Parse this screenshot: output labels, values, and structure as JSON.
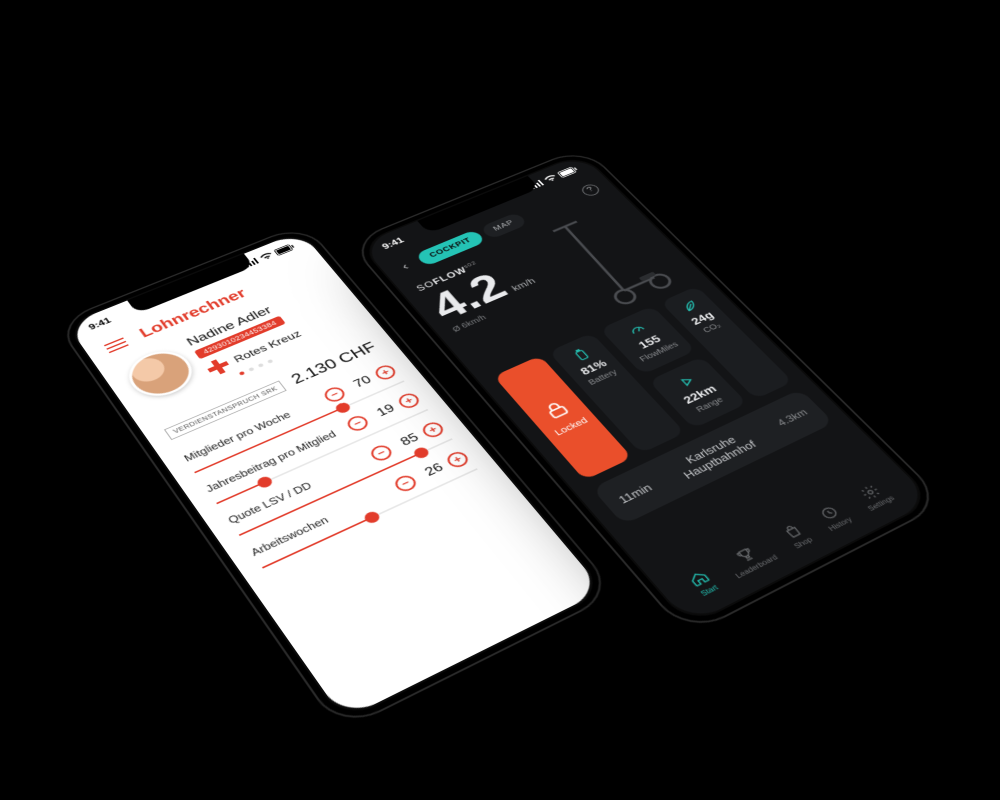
{
  "status": {
    "time": "9:41"
  },
  "left": {
    "title": "Lohnrechner",
    "user_name": "Nadine Adler",
    "user_id": "4293010234453384",
    "org": "Rotes Kreuz",
    "earn_label": "VERDIENSTANSPRUCH SRK",
    "earn_value": "2.130 CHF",
    "sliders": [
      {
        "label": "Mitglieder pro Woche",
        "value": "70",
        "pct": 70
      },
      {
        "label": "Jahresbeitrag pro Mitglied",
        "value": "19",
        "pct": 22
      },
      {
        "label": "Quote LSV / DD",
        "value": "85",
        "pct": 85
      },
      {
        "label": "Arbeitswochen",
        "value": "26",
        "pct": 50
      }
    ]
  },
  "right": {
    "tabs": {
      "cockpit": "COCKPIT",
      "map": "MAP"
    },
    "brand": "SOFLOW",
    "brand_model": "s02",
    "speed": "4.2",
    "speed_unit": "km/h",
    "avg": "Ø 6km/h",
    "tiles": {
      "locked": "Locked",
      "battery": {
        "value": "81%",
        "label": "Battery"
      },
      "flowmiles": {
        "value": "155",
        "label": "FlowMiles"
      },
      "range": {
        "value": "22km",
        "label": "Range"
      },
      "co2": {
        "value": "24g",
        "label": "CO₂"
      }
    },
    "dest": {
      "eta": "11min",
      "name": "Karlsruhe Hauptbahnhof",
      "dist": "4.3km"
    },
    "nav": {
      "start": "Start",
      "leaderboard": "Leaderboard",
      "shop": "Shop",
      "history": "History",
      "settings": "Settings"
    }
  }
}
